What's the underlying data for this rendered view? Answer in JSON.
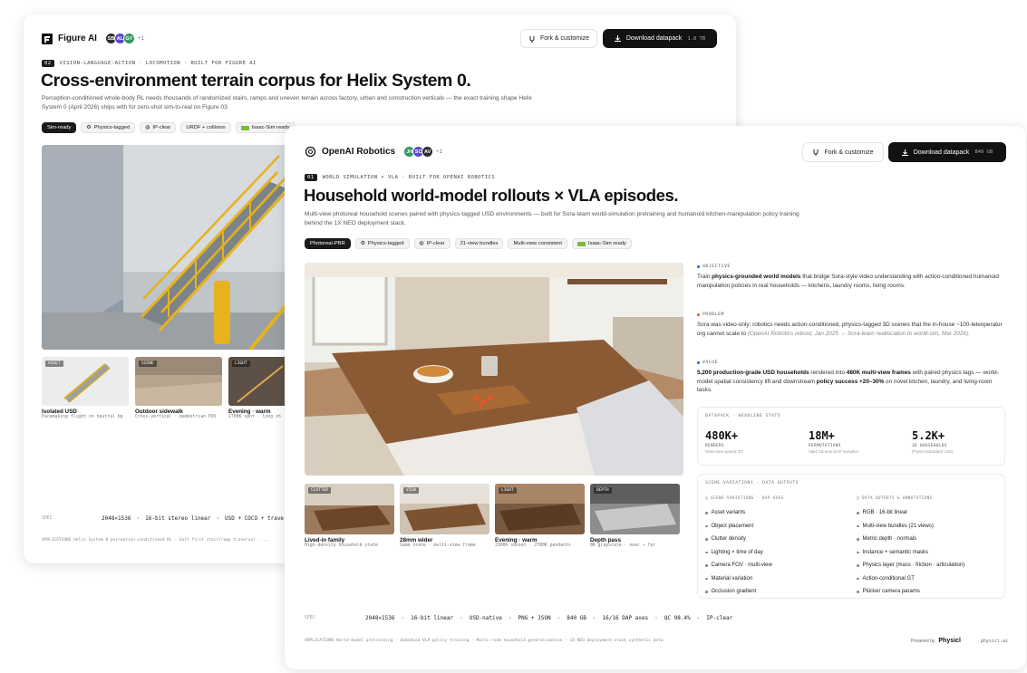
{
  "back": {
    "brand": "Figure AI",
    "avatars": [
      "SB",
      "AL",
      "GY"
    ],
    "more": "+1",
    "fork": "Fork & customize",
    "download": "Download datapack",
    "size": "1.8 TB",
    "eyebrow_num": "02",
    "eyebrow": "VISION-LANGUAGE-ACTION · LOCOMOTION · BUILT FOR FIGURE AI",
    "title": "Cross-environment terrain corpus for Helix System 0.",
    "desc": "Perception-conditioned whole-body RL needs thousands of randomized stairs, ramps and uneven terrain across factory, urban and construction verticals — the exact training shape Helix System 0 (April 2026) ships with for zero-shot sim-to-real on Figure 03.",
    "tags": [
      "Sim-ready",
      "Physics-tagged",
      "IP-clear",
      "URDF + collision",
      "Isaac-Sim ready"
    ],
    "thumbs": [
      {
        "label": "ASSET",
        "title": "Isolated USD",
        "sub": "Pacemaking flight on neutral bg"
      },
      {
        "label": "SCENE",
        "title": "Outdoor sidewalk",
        "sub": "Cross-vertical · pedestrian POV"
      },
      {
        "label": "LIGHT",
        "title": "Evening · warm",
        "sub": "2700K spot · long sh"
      }
    ],
    "spec_label": "SPEC",
    "specs": [
      "2048×1536",
      "16-bit stereo linear",
      "USD + COCO + travers"
    ],
    "applications": "APPLICATIONS  Helix System 0 perception-conditioned RL · Gait first stair/ramp traversal · ..."
  },
  "front": {
    "brand": "OpenAI Robotics",
    "avatars": [
      "JH",
      "SC",
      "AV"
    ],
    "more": "+1",
    "fork": "Fork & customize",
    "download": "Download datapack",
    "size": "840 GB",
    "eyebrow_num": "01",
    "eyebrow": "WORLD SIMULATION × VLA · BUILT FOR OPENAI ROBOTICS",
    "title": "Household world-model rollouts × VLA episodes.",
    "desc": "Multi-view photoreal household scenes paired with physics-tagged USD environments — built for Sora-team world-simulation pretraining and humanoid kitchen-manipulation policy training behind the 1X NEO deployment stack.",
    "tags": [
      "Photoreal-PBR",
      "Physics-tagged",
      "IP-clear",
      "21-view bundles",
      "Multi-view consistent",
      "Isaac-Sim ready"
    ],
    "objective": {
      "head": "OBJECTIVE",
      "pre": "Train ",
      "bold": "physics-grounded world models",
      "post": " that bridge Sora-style video understanding with action-conditioned humanoid manipulation policies in real households — kitchens, laundry rooms, living rooms."
    },
    "problem": {
      "head": "PROBLEM",
      "text": "Sora was video-only; robotics needs action-conditioned, physics-tagged 3D scenes that the in-house ~100-teleoperator org cannot scale to ",
      "italic": "(OpenAI Robotics reboot, Jan 2025 → Sora-team reallocation to world-sim, Mar 2026)."
    },
    "value": {
      "head": "VALUE",
      "b1": "5,200 production-grade USD households",
      "t1": " rendered into ",
      "b2": "480K multi-view frames",
      "t2": " with paired physics tags — world-model spatial consistency lift and downstream ",
      "b3": "policy success +20–30%",
      "t3": " on novel kitchen, laundry, and living-room tasks."
    },
    "stats_head": "DATAPACK · HEADLINE STATS",
    "stats": [
      {
        "value": "480K+",
        "key": "RENDERS",
        "sub": "Multi-view paired GT"
      },
      {
        "value": "18M+",
        "key": "PERMUTATIONS",
        "sub": "Valid 16-axis DAP samples"
      },
      {
        "value": "5.2K+",
        "key": "3D HOUSEHOLDS",
        "sub": "PhysicsStandard USD"
      }
    ],
    "var_head": "SCENE VARIATIONS · DATA OUTPUTS",
    "col1_head": "SCENE VARIATIONS · DAP AXES",
    "col1": [
      "Asset variants",
      "Object placement",
      "Clutter density",
      "Lighting × time of day",
      "Camera FOV · multi-view",
      "Material variation",
      "Occlusion gradient"
    ],
    "col2_head": "DATA OUTPUTS & ANNOTATIONS",
    "col2": [
      "RGB · 16-bit linear",
      "Multi-view bundles (21 views)",
      "Metric depth · normals",
      "Instance + semantic masks",
      "Physics layer (mass · friction · articulation)",
      "Action-conditional GT",
      "Plücker camera params"
    ],
    "thumbs": [
      {
        "label": "CLUTTER",
        "title": "Lived-in family",
        "sub": "High-density household state"
      },
      {
        "label": "VIEW",
        "title": "28mm wider",
        "sub": "Same scene · multi-view frame"
      },
      {
        "label": "LIGHT",
        "title": "Evening · warm",
        "sub": "2300K sunset · 2700K pendants"
      },
      {
        "label": "DEPTH",
        "title": "Depth pass",
        "sub": "8K grayscale · near → far"
      }
    ],
    "spec_label": "SPEC",
    "specs": [
      "2048×1536",
      "16-bit linear",
      "USD-native",
      "PNG + JSON",
      "840 GB",
      "16/16 DAP axes",
      "QC 98.4%",
      "IP-clear"
    ],
    "applications": "APPLICATIONS  World-model pretraining · Embodied VLA policy training · Multi-room household generalization · 1X NEO deployment-stack synthetic data",
    "powered": "Powered by",
    "powered_brand": "Physicl",
    "url": "physicl.ai"
  },
  "colors": {
    "accent": "#2a64d8",
    "dark": "#121212",
    "railing": "#e6b21e",
    "isaac": "#7dbb3a"
  }
}
